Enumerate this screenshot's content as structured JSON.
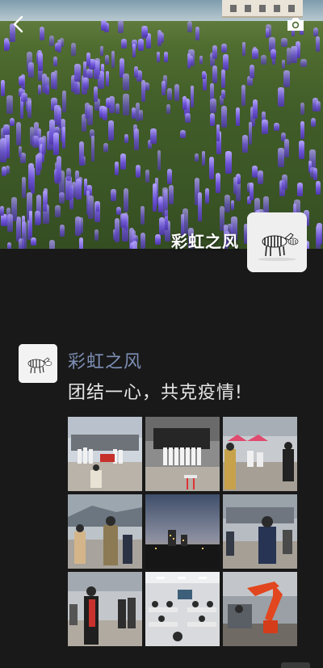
{
  "profile": {
    "name": "彩虹之风"
  },
  "cover": {
    "back_icon": "chevron-left-icon",
    "camera_icon": "camera-icon"
  },
  "post": {
    "author": "彩虹之风",
    "text": "团结一心，共克疫情!",
    "photo_count": 9
  },
  "colors": {
    "background": "#191919",
    "author_link": "#7d8fb5",
    "text": "#e6e6e6"
  }
}
